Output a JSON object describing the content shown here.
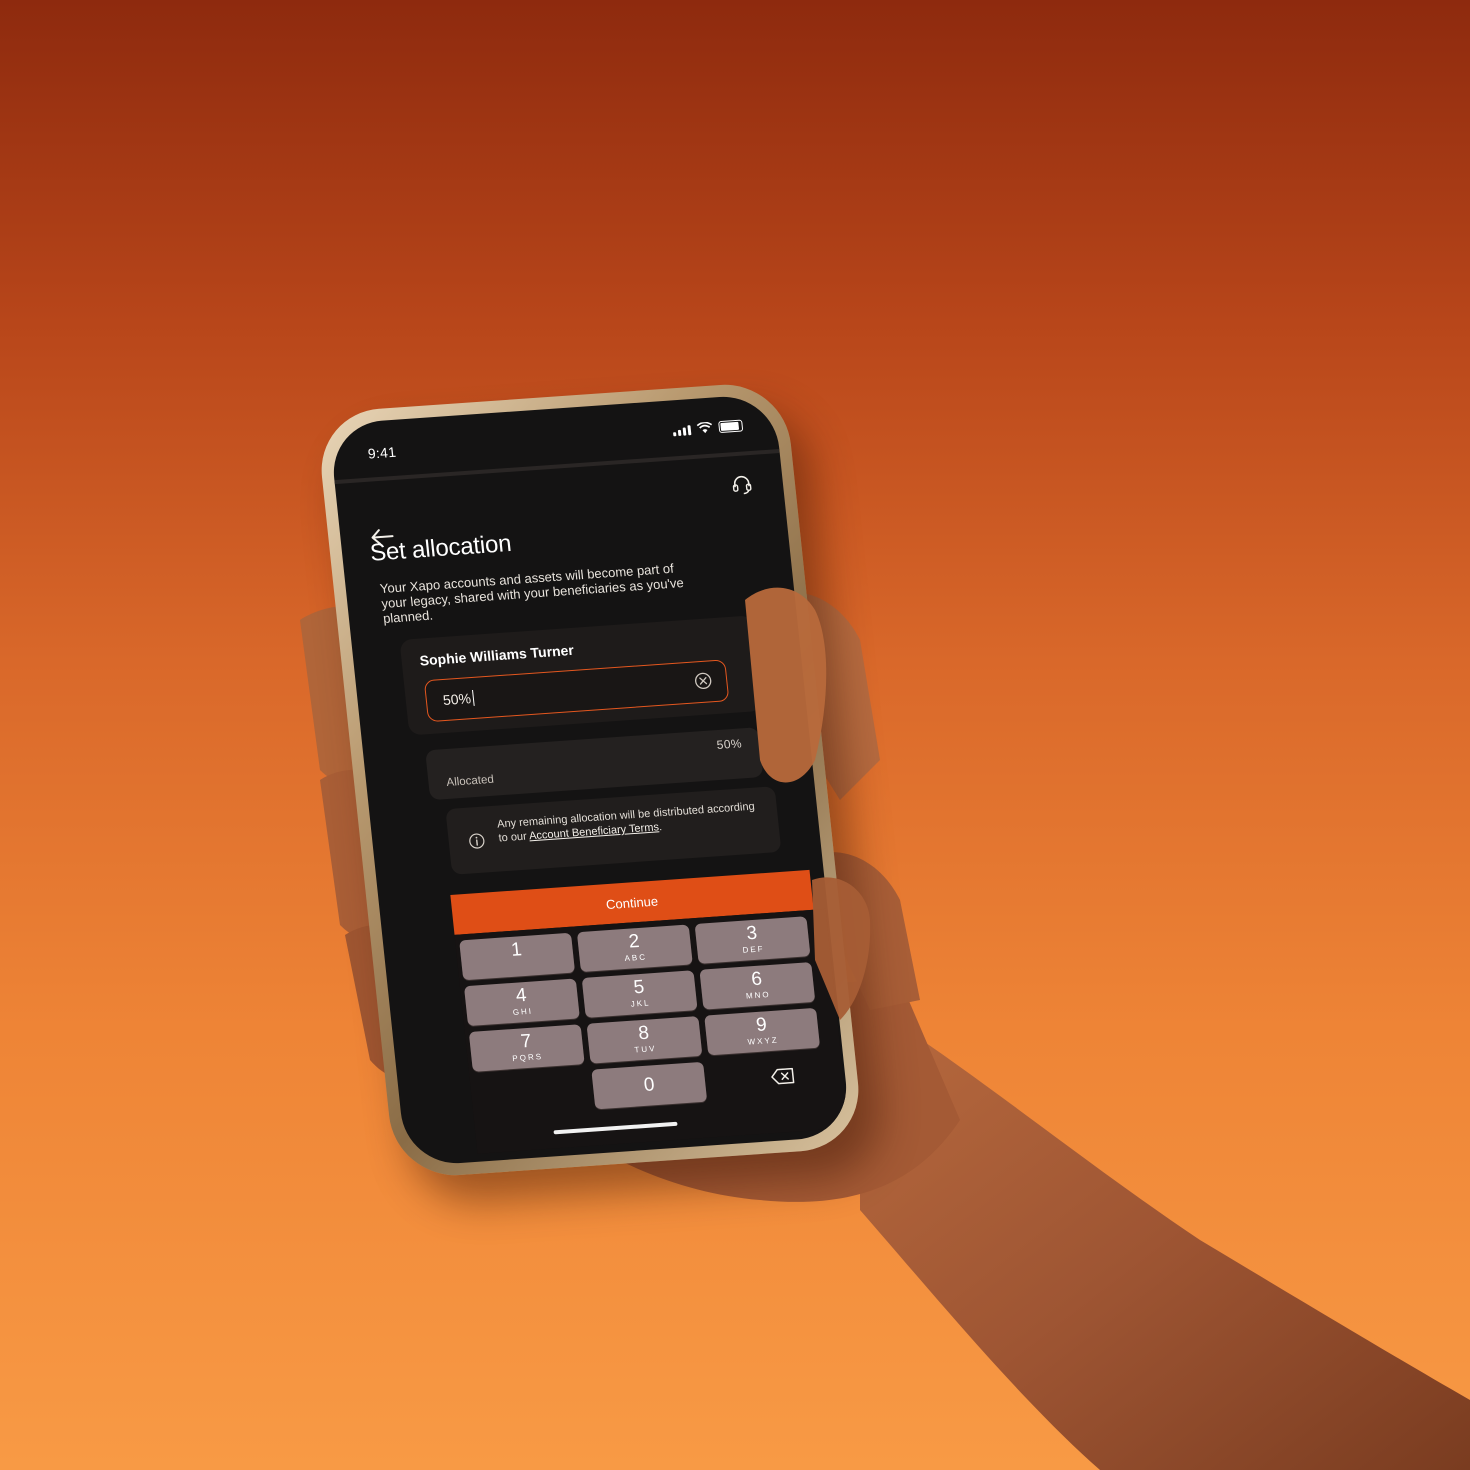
{
  "status": {
    "time": "9:41"
  },
  "header": {
    "back_icon": "arrow-left-icon",
    "support_icon": "headset-icon"
  },
  "page": {
    "title": "Set allocation",
    "intro": "Your Xapo accounts and assets will become part of your legacy, shared with your beneficiaries as you've planned."
  },
  "beneficiary": {
    "name": "Sophie Williams Turner",
    "allocation_value": "50%",
    "clear_icon": "clear-circle-icon"
  },
  "summary": {
    "label": "Allocated",
    "value": "50%"
  },
  "info": {
    "text_prefix": "Any remaining allocation will be distributed according to our ",
    "link_text": "Account Beneficiary Terms",
    "text_suffix": ".",
    "icon": "info-icon"
  },
  "actions": {
    "continue_label": "Continue"
  },
  "keypad": {
    "keys": [
      {
        "digit": "1",
        "letters": ""
      },
      {
        "digit": "2",
        "letters": "ABC"
      },
      {
        "digit": "3",
        "letters": "DEF"
      },
      {
        "digit": "4",
        "letters": "GHI"
      },
      {
        "digit": "5",
        "letters": "JKL"
      },
      {
        "digit": "6",
        "letters": "MNO"
      },
      {
        "digit": "7",
        "letters": "PQRS"
      },
      {
        "digit": "8",
        "letters": "TUV"
      },
      {
        "digit": "9",
        "letters": "WXYZ"
      },
      {
        "digit": "0",
        "letters": ""
      }
    ],
    "delete_icon": "backspace-icon"
  },
  "colors": {
    "accent": "#df4e16",
    "screen_bg": "#141313",
    "key_bg": "#8d7b7d",
    "background_top": "#8e2a0e",
    "background_bottom": "#f89a45"
  }
}
